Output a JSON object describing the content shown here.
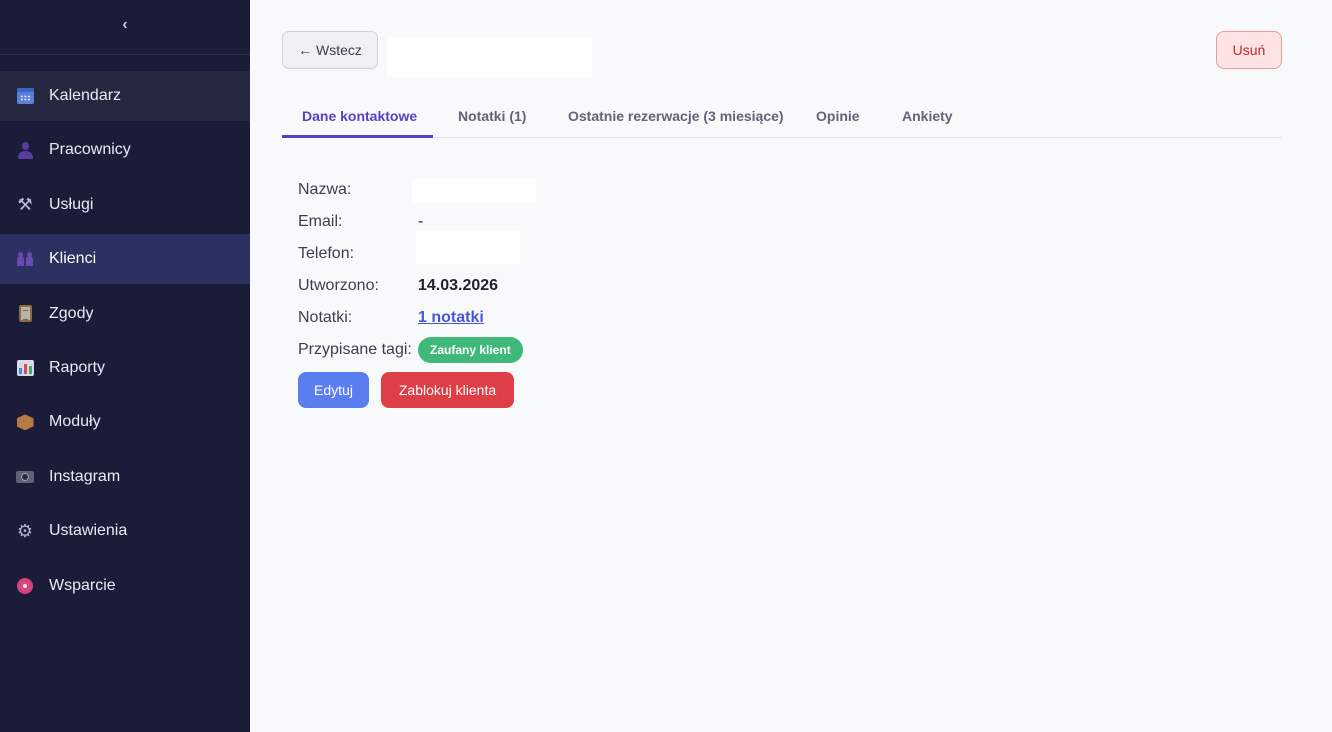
{
  "sidebar": {
    "collapse_icon": "chevron-left-icon",
    "collapse_glyph": "‹",
    "items": [
      {
        "label": "Kalendarz",
        "icon": "calendar-icon"
      },
      {
        "label": "Pracownicy",
        "icon": "person-icon"
      },
      {
        "label": "Usługi",
        "icon": "tools-icon"
      },
      {
        "label": "Klienci",
        "icon": "people-icon"
      },
      {
        "label": "Zgody",
        "icon": "clipboard-icon"
      },
      {
        "label": "Raporty",
        "icon": "bar-chart-icon"
      },
      {
        "label": "Moduły",
        "icon": "package-icon"
      },
      {
        "label": "Instagram",
        "icon": "camera-icon"
      },
      {
        "label": "Ustawienia",
        "icon": "gear-icon"
      },
      {
        "label": "Wsparcie",
        "icon": "lifebuoy-icon"
      }
    ],
    "active_item": "Klienci"
  },
  "header": {
    "back_label": "← Wstecz",
    "delete_label": "Usuń"
  },
  "tabs": [
    {
      "label": "Dane kontaktowe",
      "active": true
    },
    {
      "label": "Notatki (1)",
      "active": false
    },
    {
      "label": "Ostatnie rezerwacje (3 miesiące)",
      "active": false
    },
    {
      "label": "Opinie",
      "active": false
    },
    {
      "label": "Ankiety",
      "active": false
    }
  ],
  "contact": {
    "name_label": "Nazwa:",
    "email_label": "Email:",
    "email_value": "-",
    "phone_label": "Telefon:",
    "created_label": "Utworzono:",
    "created_value": "14.03.2026",
    "notes_label": "Notatki:",
    "notes_value": "1 notatki",
    "tags_label": "Przypisane tagi:",
    "tags": [
      "Zaufany klient"
    ],
    "tag_color": "#3fb87a"
  },
  "actions": {
    "edit_label": "Edytuj",
    "block_label": "Zablokuj klienta"
  },
  "colors": {
    "sidebar_bg": "#1b1d38",
    "sidebar_active": "#2b3160",
    "accent": "#5b3fc4",
    "edit_button": "#5a7ef0",
    "block_button": "#de3e45"
  }
}
